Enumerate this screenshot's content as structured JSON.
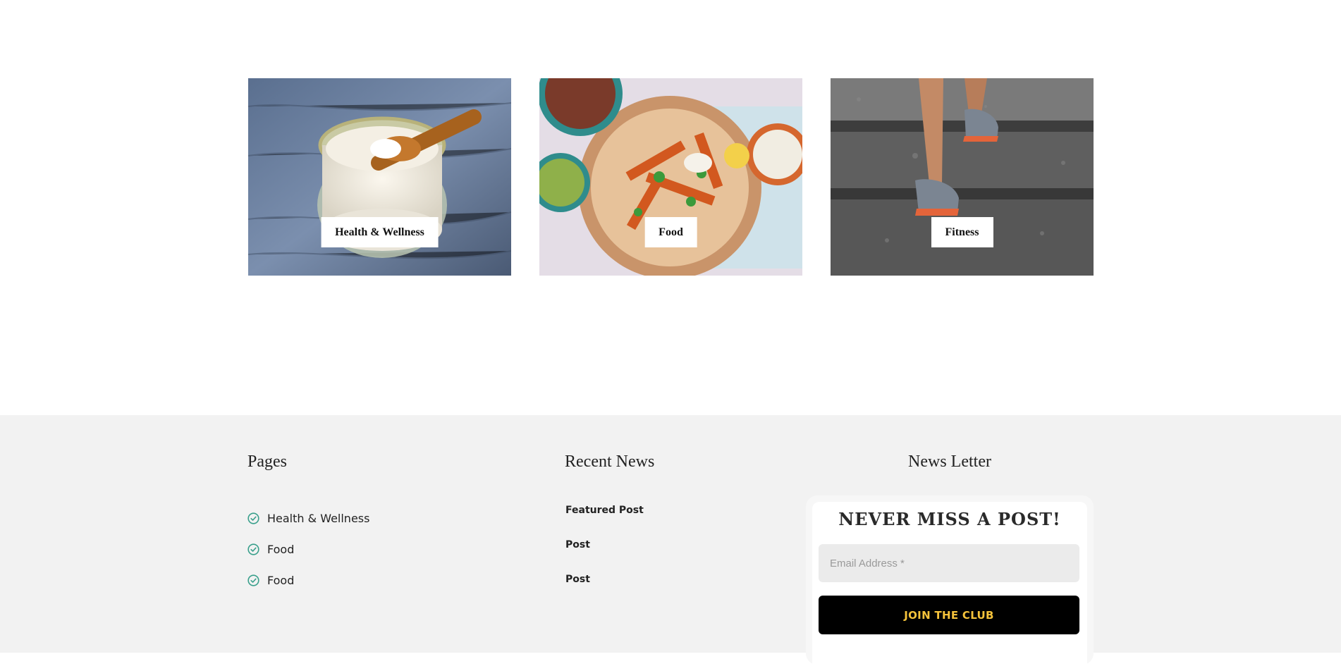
{
  "categories": [
    {
      "label": "Health & Wellness",
      "image": "coconut-oil-jar-photo"
    },
    {
      "label": "Food",
      "image": "sweet-potato-fries-bowl-photo"
    },
    {
      "label": "Fitness",
      "image": "running-up-stairs-photo"
    }
  ],
  "footer": {
    "pages": {
      "title": "Pages",
      "items": [
        "Health & Wellness",
        "Food",
        "Food"
      ],
      "icon": "check-circle-icon",
      "icon_color": "#3aa08c"
    },
    "recent_news": {
      "title": "Recent News",
      "items": [
        "Featured Post",
        "Post",
        "Post"
      ]
    },
    "newsletter": {
      "title": "News Letter",
      "heading": "NEVER MISS A POST!",
      "email_placeholder": "Email Address *",
      "button_label": "JOIN THE CLUB",
      "button_text_color": "#f5c33b",
      "button_bg_color": "#000000"
    }
  },
  "colors": {
    "footer_bg": "#f2f2f2",
    "page_bg": "#ffffff"
  }
}
